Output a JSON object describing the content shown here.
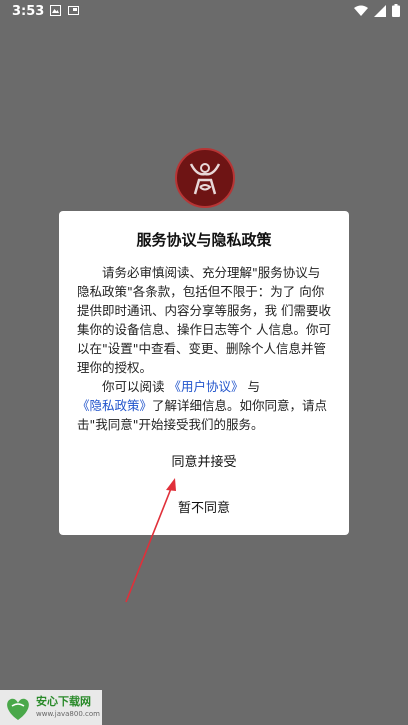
{
  "status_bar": {
    "time": "3:53"
  },
  "dialog": {
    "title": "服务协议与隐私政策",
    "para1": "请务必审慎阅读、充分理解\"服务协议与 隐私政策\"各条款，包括但不限于：为了 向你提供即时通讯、内容分享等服务，我 们需要收集你的设备信息、操作日志等个 人信息。你可以在\"设置\"中查看、变更、删除个人信息并管理你的授权。",
    "para2_prefix": "你可以阅读",
    "user_agreement_link": "《用户协议》",
    "para2_and": "与",
    "privacy_policy_link": "《隐私政策》",
    "para2_suffix": "了解详细信息。如你同意，请点击\"我同意\"开始接受我们的服务。",
    "accept_button": "同意并接受",
    "decline_button": "暂不同意"
  },
  "watermark": {
    "name": "安心下载网",
    "url": "www.java800.com"
  },
  "colors": {
    "overlay": "#6b6b6b",
    "link": "#2255cc",
    "arrow": "#e0303a",
    "logo_red": "#6e1414"
  }
}
